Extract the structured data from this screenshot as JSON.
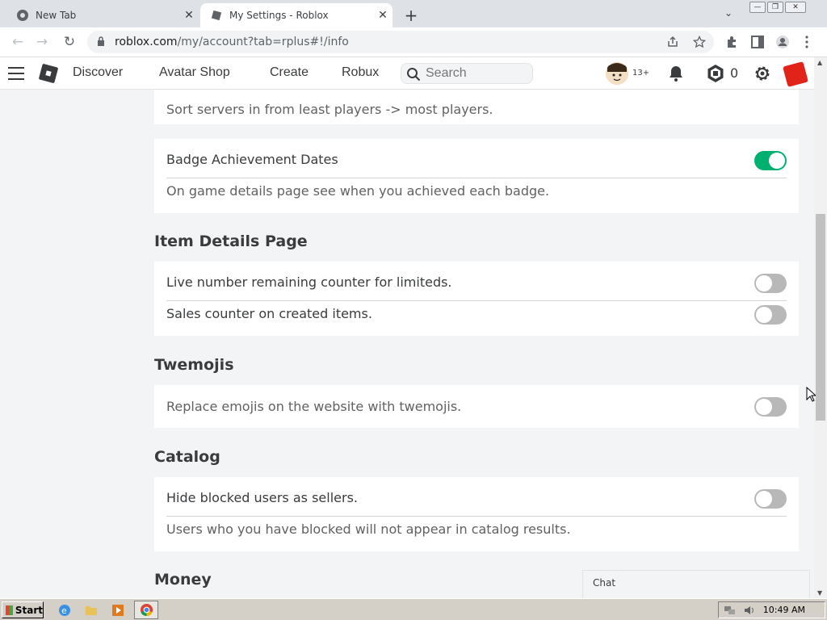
{
  "browser": {
    "tabs": [
      {
        "title": "New Tab",
        "active": false
      },
      {
        "title": "My Settings - Roblox",
        "active": true
      }
    ],
    "url_host": "roblox.com",
    "url_path": "/my/account?tab=rplus#!/info"
  },
  "header": {
    "nav": [
      "Discover",
      "Avatar Shop",
      "Create",
      "Robux"
    ],
    "search_placeholder": "Search",
    "age_badge": "13+",
    "robux_count": "0"
  },
  "content": {
    "top_desc": "Sort servers in from least players -> most players.",
    "badge_card": {
      "label": "Badge Achievement Dates",
      "desc": "On game details page see when you achieved each badge.",
      "enabled": true
    },
    "item_details": {
      "title": "Item Details Page",
      "rows": [
        {
          "label": "Live number remaining counter for limiteds.",
          "enabled": false
        },
        {
          "label": "Sales counter on created items.",
          "enabled": false
        }
      ]
    },
    "twemojis": {
      "title": "Twemojis",
      "desc": "Replace emojis on the website with twemojis.",
      "enabled": false
    },
    "catalog": {
      "title": "Catalog",
      "label": "Hide blocked users as sellers.",
      "desc": "Users who you have blocked will not appear in catalog results.",
      "enabled": false
    },
    "money_title": "Money"
  },
  "chat": {
    "label": "Chat"
  },
  "taskbar": {
    "start_label": "Start",
    "clock": "10:49 AM"
  },
  "colors": {
    "toggle_on": "#00b06f",
    "toggle_off": "#b8b8b8",
    "roblox_red": "#e2231a"
  }
}
